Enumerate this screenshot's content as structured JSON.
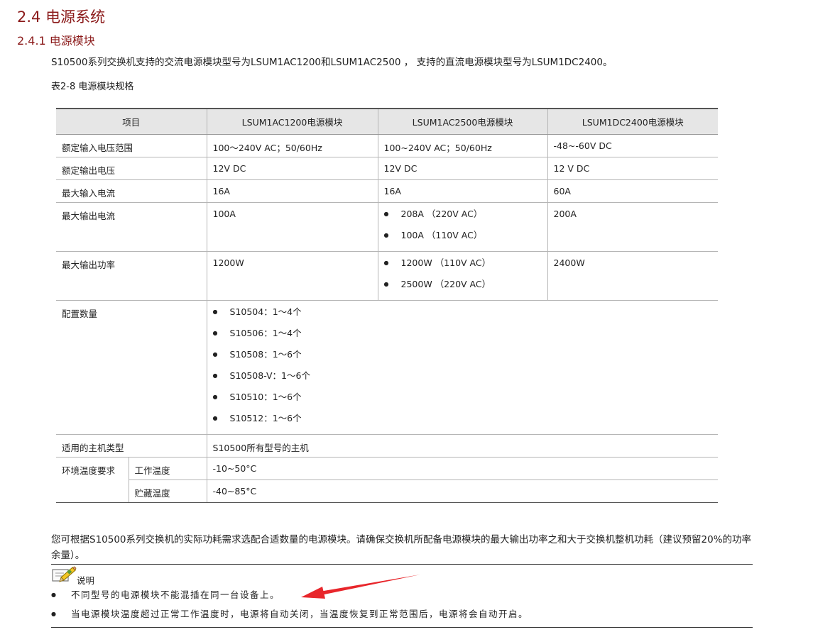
{
  "section": {
    "title": "2.4  电源系统",
    "subtitle": "2.4.1  电源模块",
    "intro": "S10500系列交换机支持的交流电源模块型号为LSUM1AC1200和LSUM1AC2500 ， 支持的直流电源模块型号为LSUM1DC2400。",
    "table_caption": "表2-8 电源模块规格"
  },
  "table": {
    "headers": [
      "项目",
      "LSUM1AC1200电源模块",
      "LSUM1AC2500电源模块",
      "LSUM1DC2400电源模块"
    ],
    "rows": {
      "input_voltage": {
        "label": "额定输入电压范围",
        "ac1200": "100～240V AC；50/60Hz",
        "ac2500": "100~240V AC；50/60Hz",
        "dc2400": "-48~-60V DC"
      },
      "output_voltage": {
        "label": "额定输出电压",
        "ac1200": "12V DC",
        "ac2500": "12V DC",
        "dc2400": "12 V DC"
      },
      "input_current": {
        "label": "最大输入电流",
        "ac1200": "16A",
        "ac2500": "16A",
        "dc2400": "60A"
      },
      "output_current": {
        "label": "最大输出电流",
        "ac1200": "100A",
        "ac2500": [
          "208A （220V AC）",
          "100A （110V AC）"
        ],
        "dc2400": "200A"
      },
      "output_power": {
        "label": "最大输出功率",
        "ac1200": "1200W",
        "ac2500": [
          "1200W （110V AC）",
          "2500W （220V AC）"
        ],
        "dc2400": "2400W"
      },
      "config": {
        "label": "配置数量",
        "items": [
          "S10504：1～4个",
          "S10506：1～4个",
          "S10508：1～6个",
          "S10508-V：1～6个",
          "S10510：1～6个",
          "S10512：1～6个"
        ]
      },
      "host": {
        "label": "适用的主机类型",
        "value": "S10500所有型号的主机"
      },
      "env": {
        "label": "环境温度要求",
        "work_label": "工作温度",
        "work": "-10~50°C",
        "store_label": "贮藏温度",
        "store": "-40~85°C"
      }
    }
  },
  "paragraph": "您可根据S10500系列交换机的实际功耗需求选配合适数量的电源模块。请确保交换机所配备电源模块的最大输出功率之和大于交换机整机功耗（建议预留20%的功率余量）。",
  "note": {
    "label": "说明",
    "items": [
      "不同型号的电源模块不能混插在同一台设备上。",
      "当电源模块温度超过正常工作温度时，电源将自动关闭，当温度恢复到正常范围后，电源将会自动开启。"
    ]
  },
  "colors": {
    "heading": "#8b1a1a",
    "table_header_bg": "#e6e6e6",
    "annotation_arrow": "#e8262b"
  }
}
